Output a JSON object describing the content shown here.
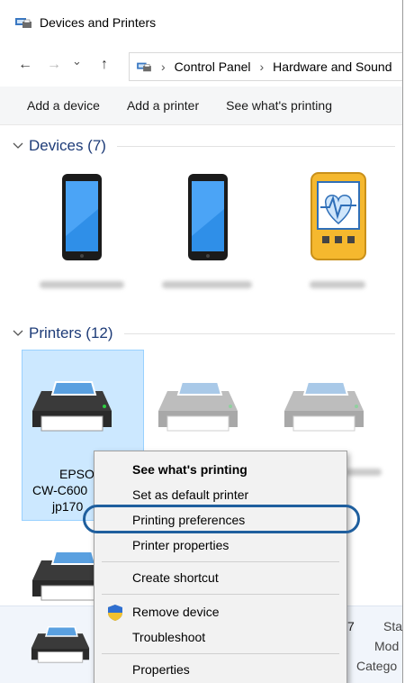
{
  "window": {
    "title": "Devices and Printers"
  },
  "address": {
    "crumbs": [
      "Control Panel",
      "Hardware and Sound"
    ],
    "separator": "›",
    "nav": {
      "back": "←",
      "forward": "→",
      "recent": "⌄",
      "up": "↑"
    }
  },
  "commands": [
    "Add a device",
    "Add a printer",
    "See what's printing"
  ],
  "groups": {
    "devices": "Devices (7)",
    "printers": "Printers (12)"
  },
  "printer_selected": {
    "line1": "EPSO",
    "line2": "CW-C600",
    "line3": "jp170"
  },
  "details": {
    "count": "7",
    "status": "Sta",
    "model": "Mod",
    "category": "Catego"
  },
  "context_menu": {
    "items": [
      "See what's printing",
      "Set as default printer",
      "Printing preferences",
      "Printer properties",
      "Create shortcut",
      "Remove device",
      "Troubleshoot",
      "Properties"
    ],
    "highlighted": "Printing preferences"
  },
  "colors": {
    "group_title": "#1e3c78",
    "selection_bg": "#cce8ff",
    "highlight_ring": "#1f5f9e",
    "menu_bg": "#f2f2f2"
  }
}
